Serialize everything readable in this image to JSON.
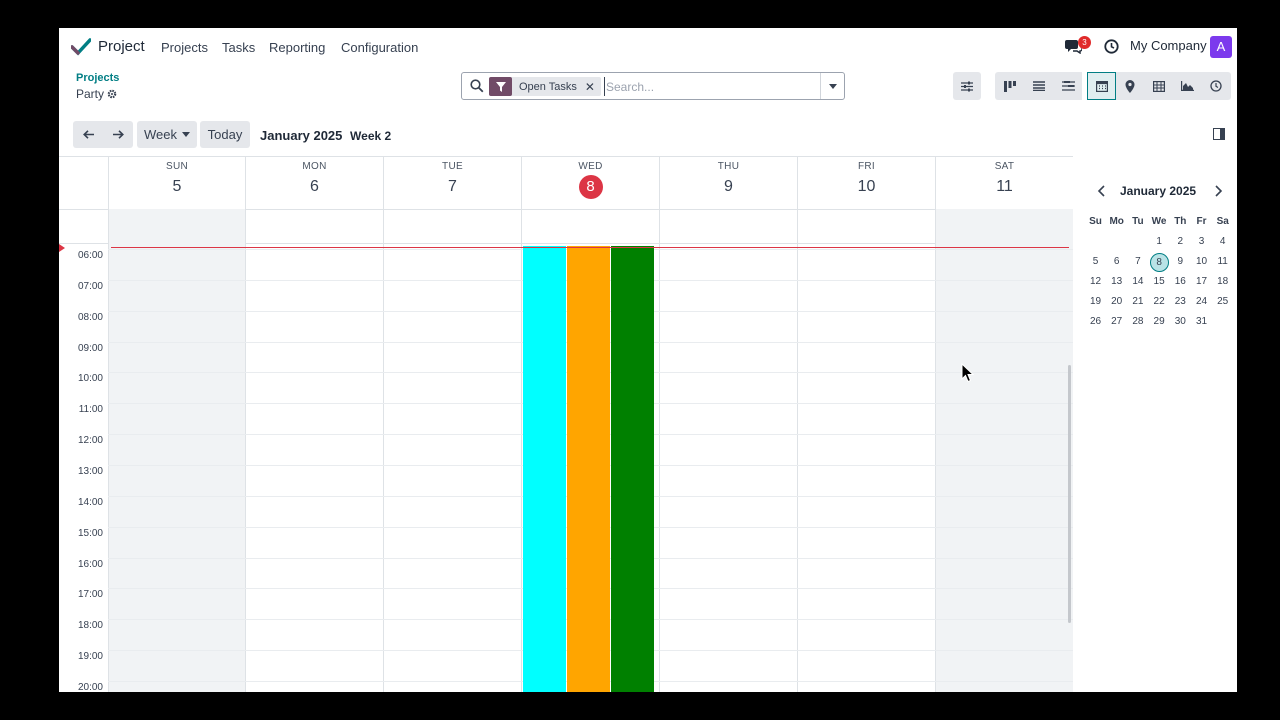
{
  "navbar": {
    "app_name": "Project",
    "menu": [
      "Projects",
      "Tasks",
      "Reporting",
      "Configuration"
    ],
    "message_count": "3",
    "company": "My Company",
    "avatar_letter": "A"
  },
  "breadcrumb": {
    "parent": "Projects",
    "current": "Party"
  },
  "search": {
    "facet": "Open Tasks",
    "placeholder": "Search..."
  },
  "views": [
    "kanban",
    "list",
    "gantt",
    "calendar",
    "map",
    "pivot",
    "graph",
    "activity"
  ],
  "active_view": "calendar",
  "toolbar": {
    "scale": "Week",
    "today": "Today",
    "period": "January 2025",
    "week": "Week 2"
  },
  "calendar": {
    "days": [
      {
        "dow": "SUN",
        "num": "5"
      },
      {
        "dow": "MON",
        "num": "6"
      },
      {
        "dow": "TUE",
        "num": "7"
      },
      {
        "dow": "WED",
        "num": "8"
      },
      {
        "dow": "THU",
        "num": "9"
      },
      {
        "dow": "FRI",
        "num": "10"
      },
      {
        "dow": "SAT",
        "num": "11"
      }
    ],
    "hours": [
      "06:00",
      "07:00",
      "08:00",
      "09:00",
      "10:00",
      "11:00",
      "12:00",
      "13:00",
      "14:00",
      "15:00",
      "16:00",
      "17:00",
      "18:00",
      "19:00",
      "20:00"
    ],
    "event_colors": [
      "#00ffff",
      "#ffa500",
      "#008000"
    ],
    "today_color": "#dc3545"
  },
  "mini_calendar": {
    "title": "January 2025",
    "dow": [
      "Su",
      "Mo",
      "Tu",
      "We",
      "Th",
      "Fr",
      "Sa"
    ],
    "weeks": [
      [
        "",
        "",
        "",
        "1",
        "2",
        "3",
        "4"
      ],
      [
        "5",
        "6",
        "7",
        "8",
        "9",
        "10",
        "11"
      ],
      [
        "12",
        "13",
        "14",
        "15",
        "16",
        "17",
        "18"
      ],
      [
        "19",
        "20",
        "21",
        "22",
        "23",
        "24",
        "25"
      ],
      [
        "26",
        "27",
        "28",
        "29",
        "30",
        "31",
        ""
      ]
    ],
    "today": "8"
  }
}
